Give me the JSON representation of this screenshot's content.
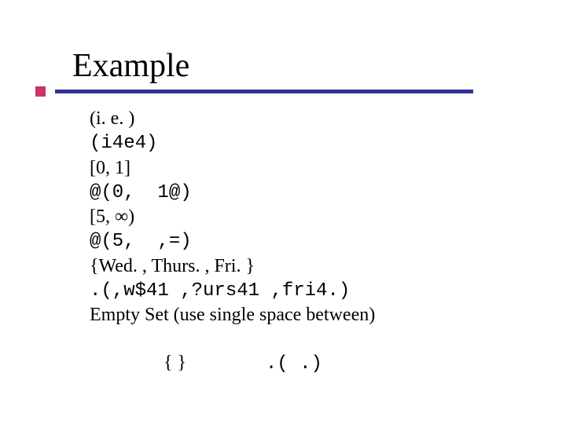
{
  "title": "Example",
  "ex1": {
    "label": "(i. e. )",
    "code": "(i4e4)"
  },
  "ex2": {
    "label": "[0, 1]",
    "code": "@(0,  1@)"
  },
  "ex3": {
    "label": "[5, ∞)",
    "code": "@(5,  ,=)"
  },
  "ex4": {
    "label": "{Wed. , Thurs. , Fri. }",
    "code": ".(,w$41 ,?urs41 ,fri4.)"
  },
  "ex5": {
    "label": "Empty Set (use single space between)",
    "braces": "{ }",
    "spacer": "       ",
    "code": ".( .)"
  }
}
